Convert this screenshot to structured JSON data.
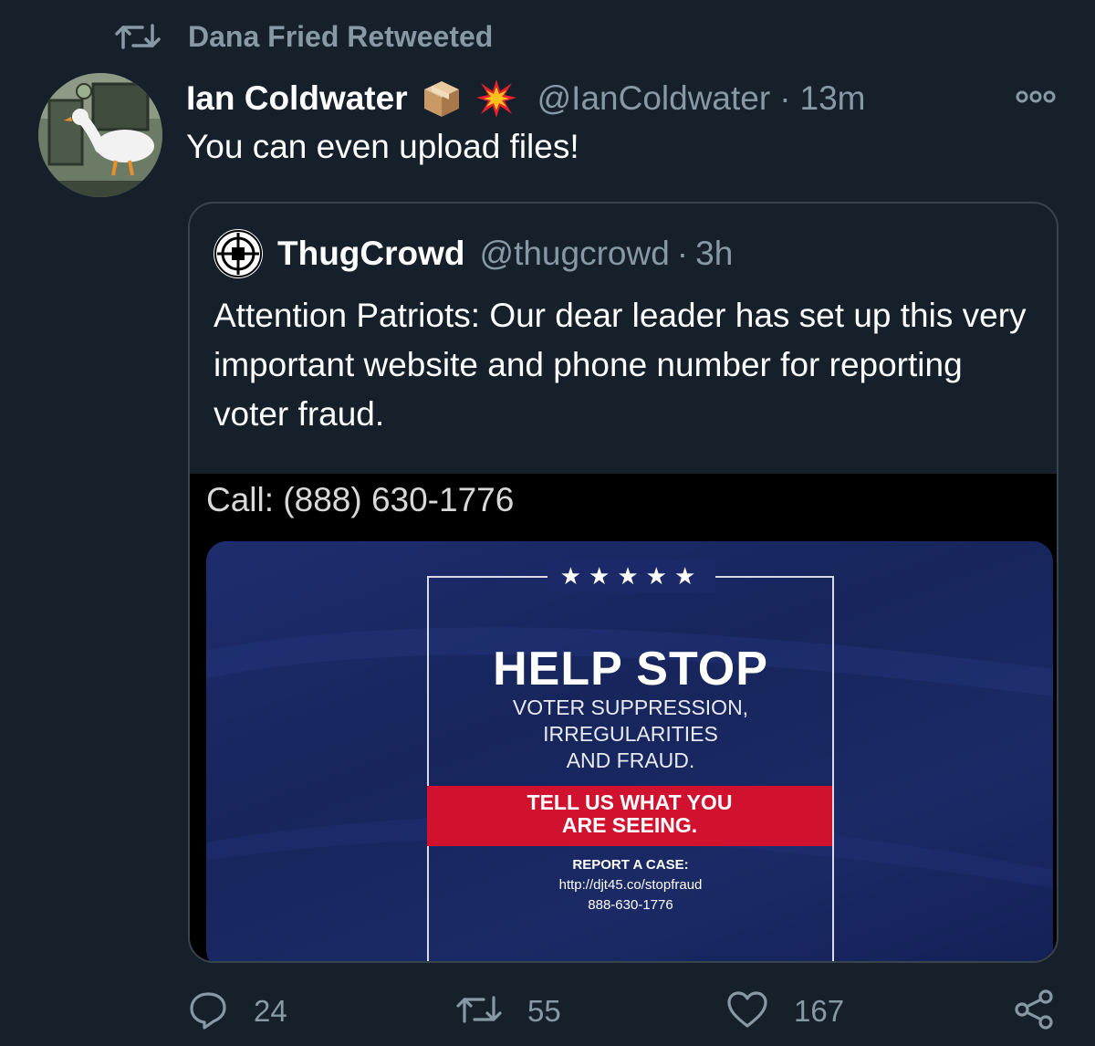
{
  "retweet_header": {
    "icon": "retweet-icon",
    "label": "Dana Fried Retweeted"
  },
  "tweet": {
    "author_name": "Ian Coldwater",
    "author_emojis": [
      "package-emoji",
      "collision-emoji"
    ],
    "handle": "@IanColdwater",
    "separator": "·",
    "time": "13m",
    "text": "You can even upload files!",
    "more_icon": "more-icon"
  },
  "quoted": {
    "author_name": "ThugCrowd",
    "handle": "@thugcrowd",
    "separator": "·",
    "time": "3h",
    "text": "Attention Patriots: Our dear leader has set up this very important website and phone number for reporting voter fraud.",
    "media": {
      "call_text": "Call: (888) 630-1776",
      "stars": "★★★★★",
      "headline": "HELP STOP",
      "sub_line1": "VOTER SUPPRESSION,",
      "sub_line2": "IRREGULARITIES",
      "sub_line3": "AND FRAUD.",
      "band_line1": "TELL US WHAT YOU",
      "band_line2": "ARE SEEING.",
      "report_title": "REPORT A CASE:",
      "report_url": "http://djt45.co/stopfraud",
      "report_phone": "888-630-1776"
    }
  },
  "actions": {
    "reply_count": "24",
    "retweet_count": "55",
    "like_count": "167"
  },
  "colors": {
    "background": "#15202b",
    "secondary_text": "#8899a6",
    "border": "#38444d",
    "flyer_red": "#d0122f",
    "flyer_blue": "#1b2a66"
  }
}
